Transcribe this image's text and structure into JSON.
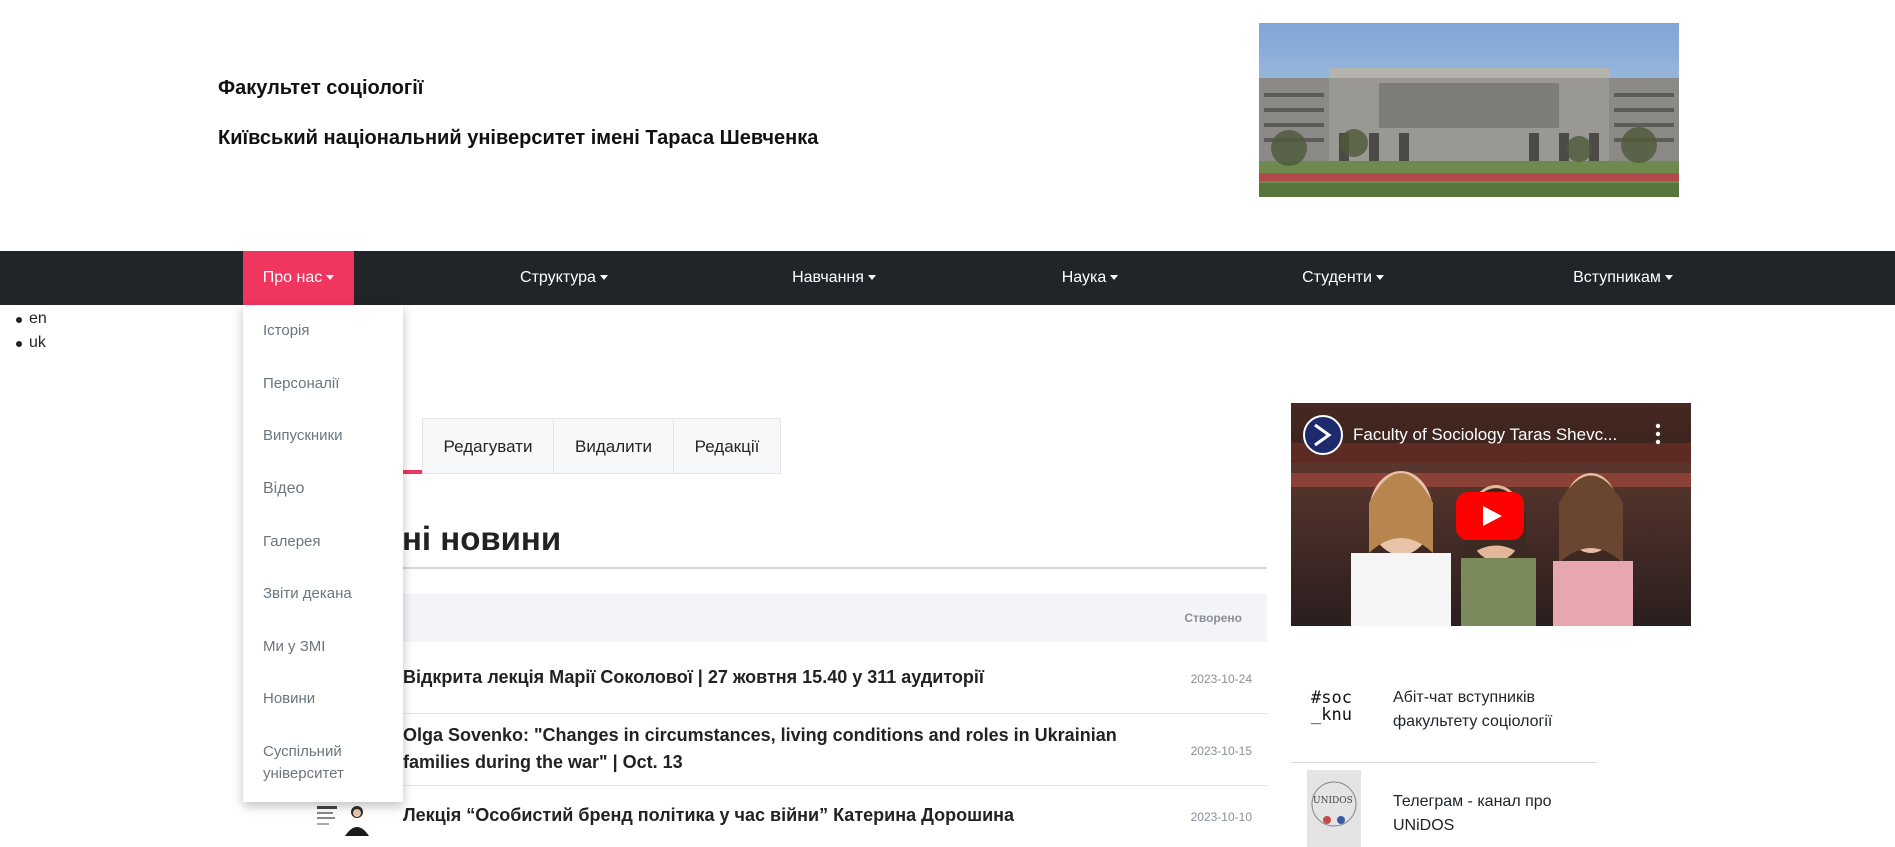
{
  "header": {
    "faculty": "Факультет соціології",
    "university": "Київський національний університет імені Тараса Шевченка"
  },
  "nav": {
    "items": [
      {
        "label": "Про нас"
      },
      {
        "label": "Структура"
      },
      {
        "label": "Навчання"
      },
      {
        "label": "Наука"
      },
      {
        "label": "Студенти"
      },
      {
        "label": "Вступникам"
      }
    ]
  },
  "languages": [
    "en",
    "uk"
  ],
  "dropdown": {
    "items": [
      "Історія",
      "Персоналії",
      "Випускники",
      "Відео",
      "Галерея",
      "Звіти декана",
      "Ми у ЗМІ",
      "Новини",
      "Суспільний університет"
    ]
  },
  "tabs": [
    "Редагувати",
    "Видалити",
    "Редакції"
  ],
  "news": {
    "heading": "ні новини",
    "created_label": "Створено",
    "items": [
      {
        "title": "Відкрита лекція Марії Соколової | 27 жовтня 15.40 у 311 аудиторії",
        "date": "2023-10-24"
      },
      {
        "title": "Olga Sovenko: \"Changes in circumstances, living conditions and roles in Ukrainian families during the war\" | Oct. 13",
        "date": "2023-10-15"
      },
      {
        "title": "Лекція “Особистий бренд політика у час війни” Катерина Дорошина",
        "date": "2023-10-10"
      }
    ]
  },
  "video": {
    "title": "Faculty of Sociology Taras Shevc..."
  },
  "side_links": [
    {
      "text": "Абіт-чат вступників факультету соціології",
      "logo": "#soc _knu"
    },
    {
      "text": "Телеграм - канал про UNiDOS",
      "logo": "UNIDOS"
    }
  ],
  "colors": {
    "accent": "#f0355f",
    "navbar": "#212529"
  }
}
